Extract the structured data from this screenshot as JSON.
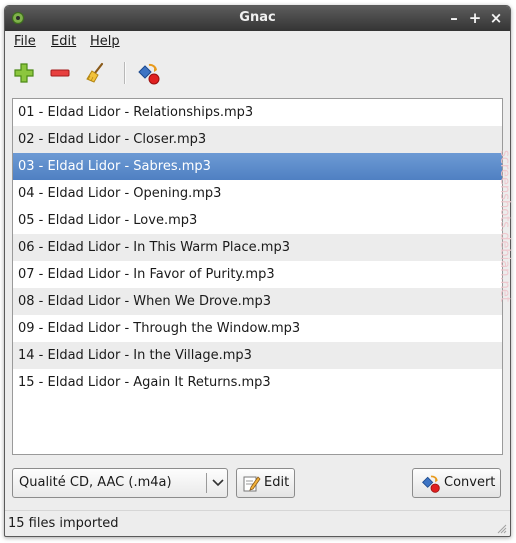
{
  "window": {
    "title": "Gnac"
  },
  "menubar": {
    "items": [
      {
        "label": "File"
      },
      {
        "label": "Edit"
      },
      {
        "label": "Help"
      }
    ]
  },
  "toolbar": {
    "buttons": [
      {
        "icon": "add-icon"
      },
      {
        "icon": "remove-icon"
      },
      {
        "icon": "clear-broom-icon"
      },
      {
        "icon": "convert-icon"
      }
    ]
  },
  "files": [
    {
      "name": "01 - Eldad Lidor - Relationships.mp3"
    },
    {
      "name": "02 - Eldad Lidor - Closer.mp3"
    },
    {
      "name": "03 - Eldad Lidor - Sabres.mp3"
    },
    {
      "name": "04 - Eldad Lidor - Opening.mp3"
    },
    {
      "name": "05 - Eldad Lidor - Love.mp3"
    },
    {
      "name": "06 - Eldad Lidor - In This Warm Place.mp3"
    },
    {
      "name": "07 - Eldad Lidor - In Favor of Purity.mp3"
    },
    {
      "name": "08 - Eldad Lidor - When We Drove.mp3"
    },
    {
      "name": "09 - Eldad Lidor - Through the Window.mp3"
    },
    {
      "name": "14 - Eldad Lidor - In the Village.mp3"
    },
    {
      "name": "15 - Eldad Lidor - Again It Returns.mp3"
    }
  ],
  "selected_file": "03 - Eldad Lidor - Sabres.mp3",
  "profile": {
    "selected": "Qualité CD, AAC (.m4a)"
  },
  "buttons": {
    "edit_label": "Edit",
    "convert_label": "Convert"
  },
  "status": {
    "text": "15 files imported"
  },
  "watermark": "screenshots.debian.net",
  "colors": {
    "selection": "#4f80c2",
    "titlebar": "#3c3c3c"
  }
}
